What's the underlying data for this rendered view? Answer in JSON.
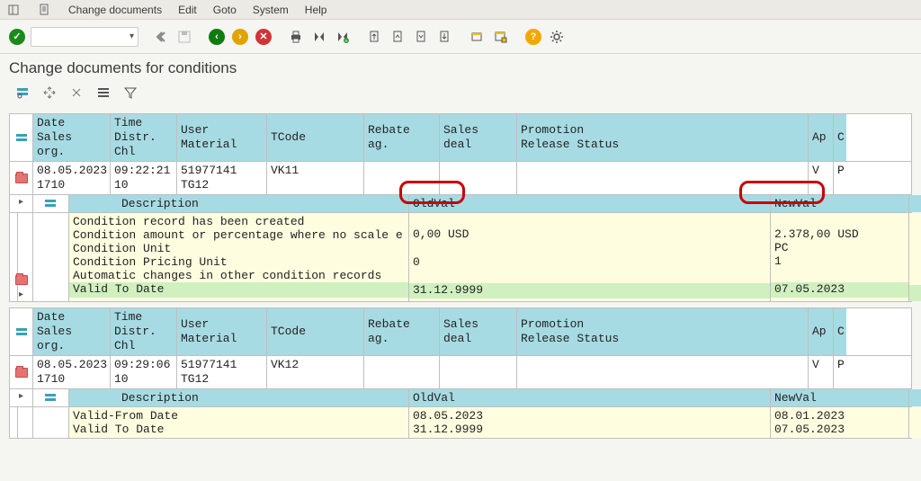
{
  "menu": {
    "items": [
      "Change documents",
      "Edit",
      "Goto",
      "System",
      "Help"
    ]
  },
  "page_title": "Change documents for conditions",
  "headers": {
    "row1": [
      "Date",
      "Time",
      "User",
      "TCode",
      "Rebate ag.",
      "Sales deal",
      "Promotion",
      "Ap",
      "C"
    ],
    "row2": [
      "Sales org.",
      "Distr. Chl",
      "Material",
      "",
      "",
      "",
      "Release Status",
      "",
      ""
    ]
  },
  "nested_headers": {
    "desc": "Description",
    "oldval": "OldVal",
    "newval": "NewVal"
  },
  "blocks": [
    {
      "row": {
        "date": "08.05.2023",
        "time": "09:22:21",
        "user": "51977141",
        "tcode": "VK11",
        "salesorg": "1710",
        "distr": "10",
        "material": "TG12",
        "ap": "V",
        "c": "P"
      },
      "details": [
        {
          "desc": "Condition record has been created",
          "old": "",
          "new": "",
          "cls": ""
        },
        {
          "desc": "Condition amount or percentage where no scale e",
          "old": "0,00 USD",
          "new": "2.378,00 USD",
          "cls": ""
        },
        {
          "desc": "Condition Unit",
          "old": "",
          "new": "PC",
          "cls": ""
        },
        {
          "desc": "Condition Pricing Unit",
          "old": "0",
          "new": "1",
          "cls": ""
        },
        {
          "desc": "Automatic changes in other condition records",
          "old": "",
          "new": "",
          "cls": ""
        },
        {
          "desc": "Valid To Date",
          "old": "31.12.9999",
          "new": "07.05.2023",
          "cls": "green"
        }
      ]
    },
    {
      "row": {
        "date": "08.05.2023",
        "time": "09:29:06",
        "user": "51977141",
        "tcode": "VK12",
        "salesorg": "1710",
        "distr": "10",
        "material": "TG12",
        "ap": "V",
        "c": "P"
      },
      "details": [
        {
          "desc": "Valid-From Date",
          "old": "08.05.2023",
          "new": "08.01.2023",
          "cls": ""
        },
        {
          "desc": "Valid To Date",
          "old": "31.12.9999",
          "new": "07.05.2023",
          "cls": ""
        }
      ]
    }
  ]
}
